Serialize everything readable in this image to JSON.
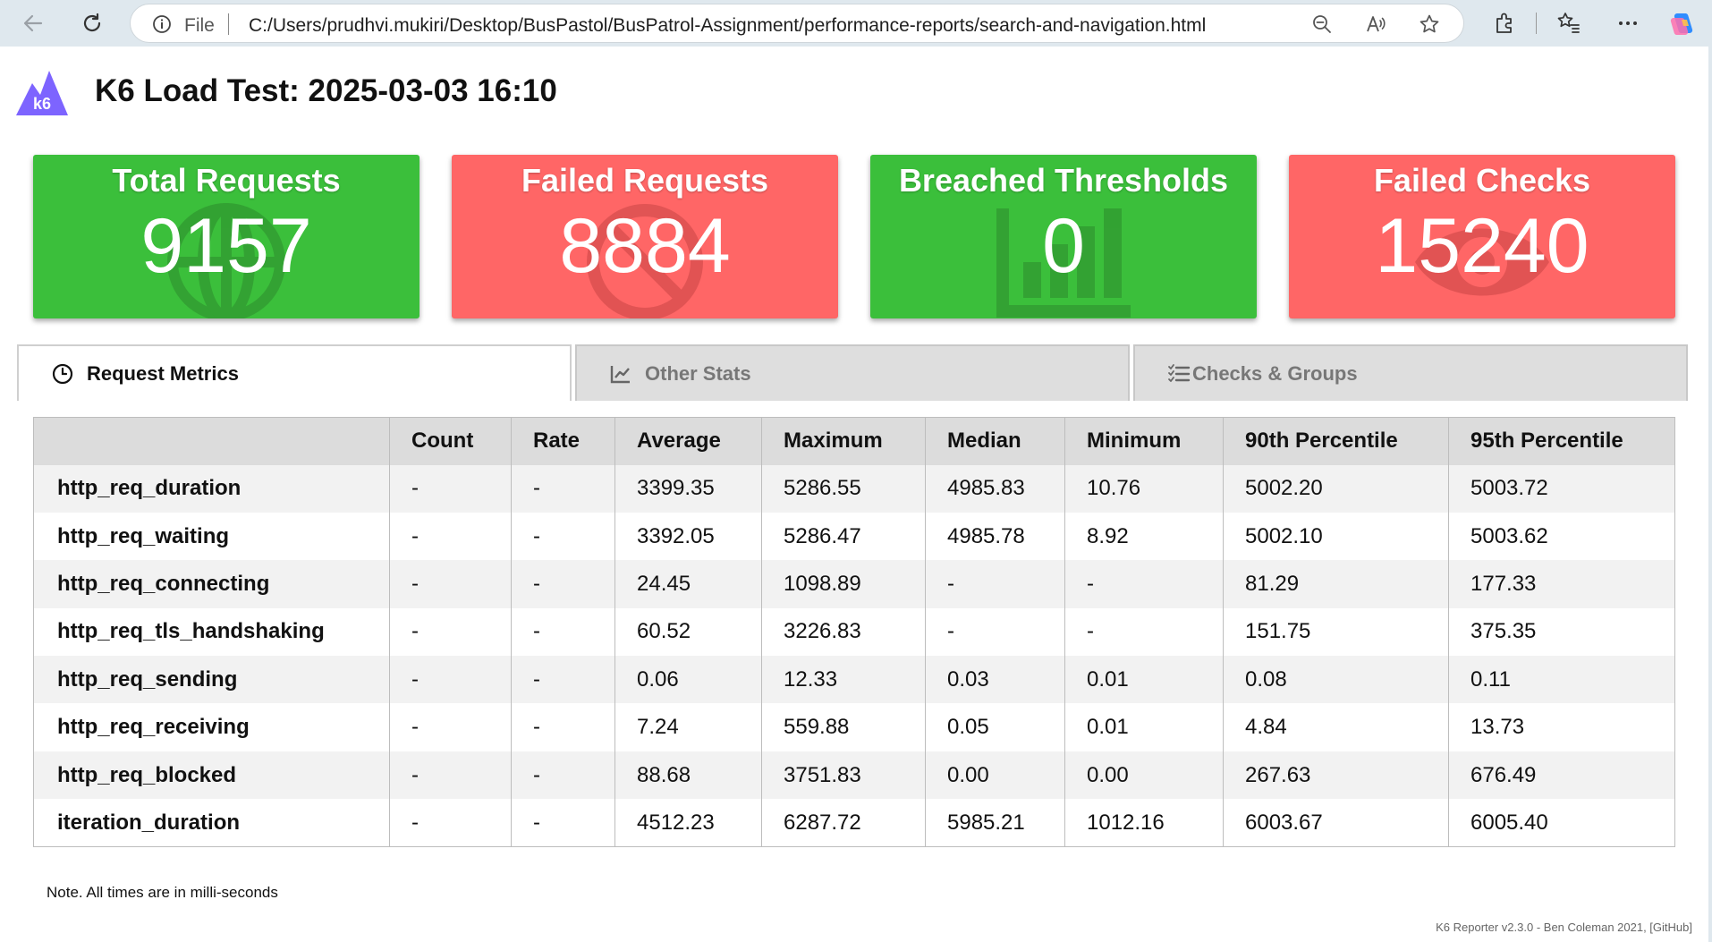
{
  "browser": {
    "file_label": "File",
    "url": "C:/Users/prudhvi.mukiri/Desktop/BusPastol/BusPatrol-Assignment/performance-reports/search-and-navigation.html",
    "icons": [
      "back-icon",
      "refresh-icon",
      "info-icon",
      "zoom-out-icon",
      "read-aloud-icon",
      "favorite-star-icon",
      "extensions-icon",
      "favorites-list-icon",
      "more-icon",
      "copilot-icon"
    ]
  },
  "header": {
    "logo_text": "k6",
    "title": "K6 Load Test: 2025-03-03 16:10"
  },
  "cards": [
    {
      "label": "Total Requests",
      "value": "9157",
      "color": "#3bbf3b",
      "icon": "globe-icon"
    },
    {
      "label": "Failed Requests",
      "value": "8884",
      "color": "#ff6666",
      "icon": "ban-icon"
    },
    {
      "label": "Breached Thresholds",
      "value": "0",
      "color": "#3bbf3b",
      "icon": "chart-bar-icon"
    },
    {
      "label": "Failed Checks",
      "value": "15240",
      "color": "#ff6666",
      "icon": "eye-icon"
    }
  ],
  "tabs": [
    {
      "label": "Request Metrics",
      "icon": "clock-icon",
      "active": true
    },
    {
      "label": "Other Stats",
      "icon": "chart-line-icon",
      "active": false
    },
    {
      "label": "Checks & Groups",
      "icon": "tasks-icon",
      "active": false
    }
  ],
  "table": {
    "headers": [
      "",
      "Count",
      "Rate",
      "Average",
      "Maximum",
      "Median",
      "Minimum",
      "90th Percentile",
      "95th Percentile"
    ],
    "rows": [
      [
        "http_req_duration",
        "-",
        "-",
        "3399.35",
        "5286.55",
        "4985.83",
        "10.76",
        "5002.20",
        "5003.72"
      ],
      [
        "http_req_waiting",
        "-",
        "-",
        "3392.05",
        "5286.47",
        "4985.78",
        "8.92",
        "5002.10",
        "5003.62"
      ],
      [
        "http_req_connecting",
        "-",
        "-",
        "24.45",
        "1098.89",
        "-",
        "-",
        "81.29",
        "177.33"
      ],
      [
        "http_req_tls_handshaking",
        "-",
        "-",
        "60.52",
        "3226.83",
        "-",
        "-",
        "151.75",
        "375.35"
      ],
      [
        "http_req_sending",
        "-",
        "-",
        "0.06",
        "12.33",
        "0.03",
        "0.01",
        "0.08",
        "0.11"
      ],
      [
        "http_req_receiving",
        "-",
        "-",
        "7.24",
        "559.88",
        "0.05",
        "0.01",
        "4.84",
        "13.73"
      ],
      [
        "http_req_blocked",
        "-",
        "-",
        "88.68",
        "3751.83",
        "0.00",
        "0.00",
        "267.63",
        "676.49"
      ],
      [
        "iteration_duration",
        "-",
        "-",
        "4512.23",
        "6287.72",
        "5985.21",
        "1012.16",
        "6003.67",
        "6005.40"
      ]
    ]
  },
  "note": "Note. All times are in milli-seconds",
  "footer": "K6 Reporter v2.3.0 - Ben Coleman 2021, [GitHub]"
}
